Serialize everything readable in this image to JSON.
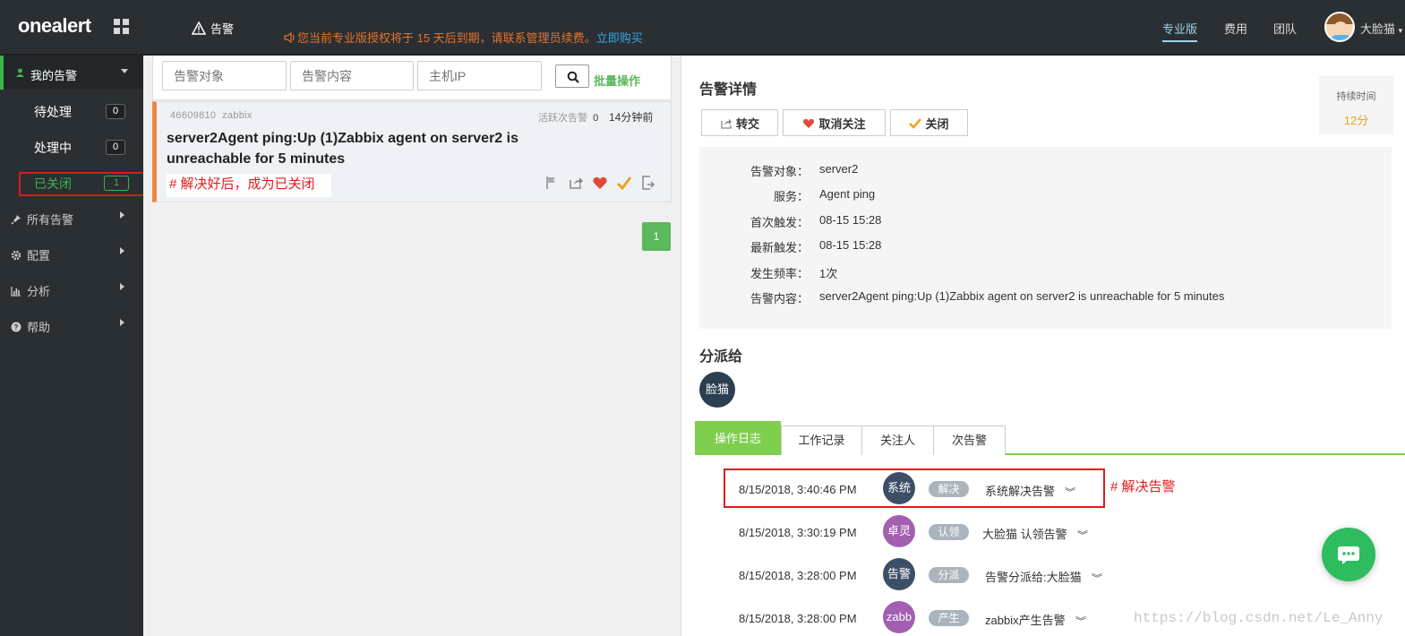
{
  "app": {
    "logo": "onealert",
    "nav_alert": "告警",
    "license_notice": "您当前专业版授权将于 15 天后到期，请联系管理员续费。",
    "license_link": "立即购买",
    "top_links": [
      "专业版",
      "费用",
      "团队"
    ],
    "user_name": "大脸猫"
  },
  "sidebar": {
    "my_alerts": "我的告警",
    "sub_items": [
      {
        "label": "待处理",
        "count": "0"
      },
      {
        "label": "处理中",
        "count": "0"
      },
      {
        "label": "已关闭",
        "count": "1"
      }
    ],
    "items": [
      {
        "label": "所有告警",
        "icon": "pin-icon"
      },
      {
        "label": "配置",
        "icon": "gear-icon"
      },
      {
        "label": "分析",
        "icon": "bar-chart-icon"
      },
      {
        "label": "帮助",
        "icon": "help-icon"
      }
    ]
  },
  "search": {
    "target_placeholder": "告警对象",
    "content_placeholder": "告警内容",
    "ip_placeholder": "主机IP",
    "batch_label": "批量操作"
  },
  "alert_card": {
    "id": "46609810",
    "source": "zabbix",
    "active_label": "活跃次告警",
    "active_count": "0",
    "time_ago": "14分钟前",
    "title": "server2Agent ping:Up (1)Zabbix agent on server2 is unreachable for 5 minutes",
    "annotation": "# 解决好后，成为已关闭"
  },
  "pagination": {
    "current": "1"
  },
  "detail": {
    "title": "告警详情",
    "buttons": [
      "转交",
      "取消关注",
      "关闭"
    ],
    "duration_label": "持续时间",
    "duration_value": "12分",
    "fields": [
      {
        "key": "告警对象：",
        "value": "server2"
      },
      {
        "key": "服务：",
        "value": "Agent ping"
      },
      {
        "key": "首次触发：",
        "value": "08-15 15:28"
      },
      {
        "key": "最新触发：",
        "value": "08-15 15:28"
      },
      {
        "key": "发生频率：",
        "value": "1次"
      },
      {
        "key": "告警内容：",
        "value": "server2Agent ping:Up (1)Zabbix agent on server2 is unreachable for 5 minutes"
      }
    ],
    "assign_title": "分派给",
    "assignee": "脸猫",
    "tabs": [
      "操作日志",
      "工作记录",
      "关注人",
      "次告警"
    ],
    "logs": [
      {
        "time": "8/15/2018, 3:40:46 PM",
        "avatar": "系统",
        "avatar_color": "#3d4f66",
        "tag": "解决",
        "message": "系统解决告警"
      },
      {
        "time": "8/15/2018, 3:30:19 PM",
        "avatar": "卓灵",
        "avatar_color": "#a35fb0",
        "tag": "认领",
        "message": "大脸猫 认领告警"
      },
      {
        "time": "8/15/2018, 3:28:00 PM",
        "avatar": "告警",
        "avatar_color": "#3d4f66",
        "tag": "分派",
        "message": "告警分派给:大脸猫"
      },
      {
        "time": "8/15/2018, 3:28:00 PM",
        "avatar": "zabb",
        "avatar_color": "#a35fb0",
        "tag": "产生",
        "message": "zabbix产生告警"
      }
    ],
    "log_annotation": "# 解决告警"
  },
  "watermark": "https://blog.csdn.net/Le_Anny",
  "colors": {
    "topbar": "#2a2f33",
    "accent_green": "#5cb85c",
    "tab_green": "#7fcf4e",
    "annotation_red": "#e0191b",
    "license_orange": "#e8712c"
  }
}
